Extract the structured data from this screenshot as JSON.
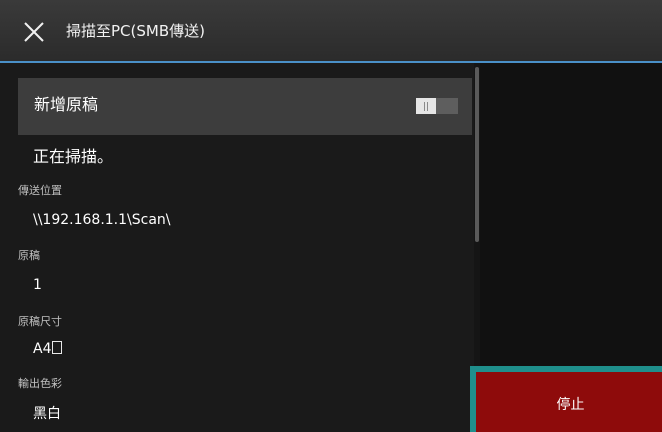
{
  "header": {
    "title": "掃描至PC(SMB傳送)"
  },
  "add_original": {
    "label": "新增原稿",
    "enabled": false
  },
  "status": "正在掃描。",
  "settings": [
    {
      "label": "傳送位置",
      "value": "\\\\192.168.1.1\\Scan\\"
    },
    {
      "label": "原稿",
      "value": "1"
    },
    {
      "label": "原稿尺寸",
      "value": "A4"
    },
    {
      "label": "輸出色彩",
      "value": "黑白"
    }
  ],
  "stop_button": {
    "label": "停止",
    "color": "#8e0b0b",
    "focus_color": "#1f8f8c"
  },
  "colors": {
    "accent": "#4a90c8",
    "background": "#1a1a1a",
    "header": "#333333"
  }
}
